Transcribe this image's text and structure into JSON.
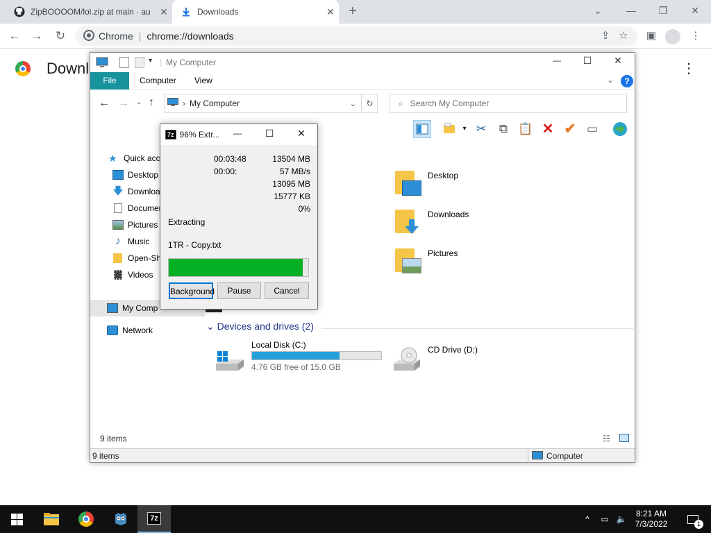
{
  "browser": {
    "tabs": [
      {
        "title": "ZipBOOOOM/lol.zip at main · au",
        "icon": "github-icon",
        "active": false
      },
      {
        "title": "Downloads",
        "icon": "download-icon",
        "active": true
      }
    ],
    "omnibox": {
      "label": "Chrome",
      "url": "chrome://downloads"
    },
    "page_title": "Downl"
  },
  "explorer": {
    "title": "My Computer",
    "ribbon_tabs": [
      "File",
      "Computer",
      "View"
    ],
    "address": "My Computer",
    "search_placeholder": "Search My Computer",
    "nav": [
      {
        "label": "Quick acce",
        "icon": "star-icon"
      },
      {
        "label": "Desktop",
        "icon": "desktop-icon"
      },
      {
        "label": "Downloa",
        "icon": "download-icon"
      },
      {
        "label": "Documen",
        "icon": "document-icon"
      },
      {
        "label": "Pictures",
        "icon": "pictures-icon"
      },
      {
        "label": "Music",
        "icon": "music-icon"
      },
      {
        "label": "Open-Sh",
        "icon": "folder-icon"
      },
      {
        "label": "Videos",
        "icon": "videos-icon"
      },
      {
        "label": "My Comp",
        "icon": "computer-icon"
      },
      {
        "label": "Network",
        "icon": "network-icon"
      }
    ],
    "folders": [
      {
        "name": "Desktop",
        "icon": "desktop-folder-icon"
      },
      {
        "name": "Downloads",
        "icon": "downloads-folder-icon"
      },
      {
        "name": "Pictures",
        "icon": "pictures-folder-icon"
      }
    ],
    "devices_header": "Devices and drives (2)",
    "drives": [
      {
        "name": "Local Disk (C:)",
        "free": "4.76 GB free of 15.0 GB",
        "used_fraction": 0.68
      },
      {
        "name": "CD Drive (D:)"
      }
    ],
    "status_items": "9 items",
    "status_bar": {
      "items": "9 items",
      "location": "Computer"
    }
  },
  "extract_dialog": {
    "title": "96% Extr...",
    "rows": [
      {
        "mid": "00:03:48",
        "right": "13504 MB"
      },
      {
        "mid": "00:00:",
        "right": "57 MB/s"
      },
      {
        "mid": "",
        "right": "13095 MB"
      },
      {
        "mid": "",
        "right": "15777 KB"
      },
      {
        "mid": "",
        "right": "0%"
      }
    ],
    "status": "Extracting",
    "file": "1TR - Copy.txt",
    "progress": 0.96,
    "buttons": {
      "background": "Background",
      "pause": "Pause",
      "cancel": "Cancel"
    }
  },
  "taskbar": {
    "time": "8:21 AM",
    "date": "7/3/2022",
    "notification_count": "1"
  },
  "colors": {
    "progress": "#06b025",
    "drive_bar": "#26a0da",
    "ribbon_file": "#17939e"
  }
}
